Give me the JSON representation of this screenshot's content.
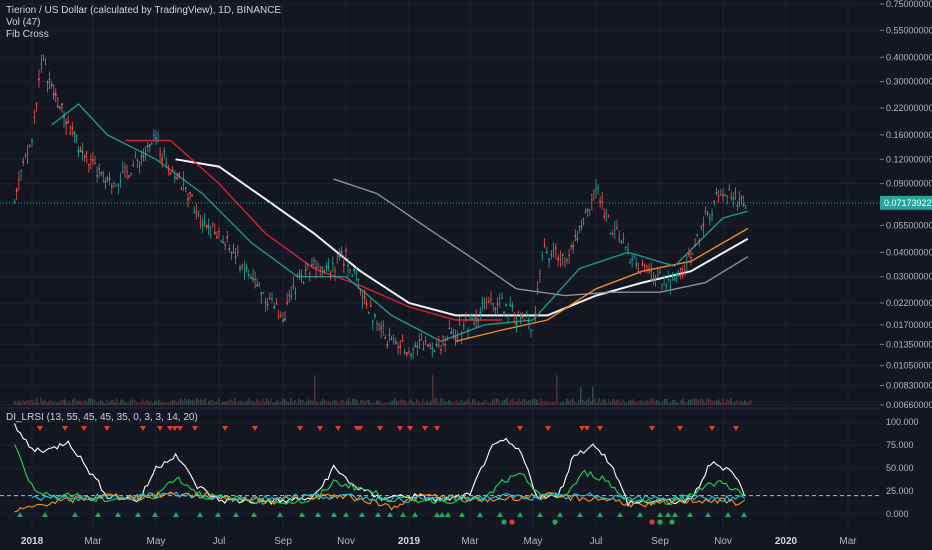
{
  "header": {
    "symbol_title": "Tierion / US Dollar (calculated by TradingView), 1D, BINANCE",
    "vol_label": "Vol (47)",
    "fib_label": "Fib Cross",
    "indicator_label": "DI_LRSI (13, 55, 45, 45, 35, 0, 3, 3, 14, 20)"
  },
  "colors": {
    "background": "#131722",
    "grid": "#1e2230",
    "candle_up": "#26a69a",
    "candle_down": "#ef5350",
    "ma_white": "#ffffff",
    "ma_gray": "#9598a1",
    "ma_orange": "#ff8f1f",
    "ma_red": "#e0233a",
    "ma_teal": "#1f9e89",
    "last_price": "#26a69a"
  },
  "chart_data": {
    "type": "line",
    "x_ticks": [
      "2018",
      "Mar",
      "May",
      "Jul",
      "Sep",
      "Nov",
      "2019",
      "Mar",
      "May",
      "Jul",
      "Sep",
      "Nov",
      "2020",
      "Mar"
    ],
    "bold_ticks": [
      "2018",
      "2019",
      "2020"
    ],
    "price_axis": {
      "scale": "log",
      "ticks": [
        "0.75000000",
        "0.55000000",
        "0.40000000",
        "0.30000000",
        "0.22000000",
        "0.16000000",
        "0.12000000",
        "0.09000000",
        "0.05500000",
        "0.04000000",
        "0.03000000",
        "0.02200000",
        "0.01700000",
        "0.01350000",
        "0.01050000",
        "0.00830000",
        "0.00660000"
      ],
      "last_price": "0.07173922"
    },
    "price_series": {
      "name": "Close",
      "x": [
        "2017-12-15",
        "2018-01-01",
        "2018-01-10",
        "2018-01-20",
        "2018-02-01",
        "2018-02-15",
        "2018-03-01",
        "2018-03-15",
        "2018-04-01",
        "2018-04-15",
        "2018-05-01",
        "2018-05-15",
        "2018-06-01",
        "2018-06-15",
        "2018-07-01",
        "2018-07-15",
        "2018-08-01",
        "2018-08-15",
        "2018-09-01",
        "2018-09-15",
        "2018-10-01",
        "2018-10-15",
        "2018-11-01",
        "2018-11-15",
        "2018-12-01",
        "2018-12-15",
        "2019-01-01",
        "2019-01-15",
        "2019-02-01",
        "2019-02-15",
        "2019-03-01",
        "2019-03-15",
        "2019-04-01",
        "2019-04-15",
        "2019-05-01",
        "2019-05-10",
        "2019-06-01",
        "2019-06-15",
        "2019-07-01",
        "2019-07-15",
        "2019-08-01",
        "2019-08-15",
        "2019-09-01",
        "2019-09-15",
        "2019-10-01",
        "2019-10-15",
        "2019-11-01",
        "2019-11-15",
        "2019-11-25"
      ],
      "y": [
        0.08,
        0.15,
        0.4,
        0.28,
        0.2,
        0.14,
        0.11,
        0.09,
        0.1,
        0.12,
        0.15,
        0.11,
        0.08,
        0.06,
        0.048,
        0.04,
        0.03,
        0.024,
        0.019,
        0.028,
        0.036,
        0.034,
        0.038,
        0.026,
        0.017,
        0.014,
        0.013,
        0.0135,
        0.014,
        0.016,
        0.018,
        0.021,
        0.022,
        0.019,
        0.017,
        0.04,
        0.038,
        0.052,
        0.085,
        0.055,
        0.04,
        0.032,
        0.03,
        0.028,
        0.038,
        0.06,
        0.085,
        0.075,
        0.072
      ]
    },
    "ma_series": [
      {
        "color": "#ffffff",
        "x": [
          "2018-05-20",
          "2018-07-01",
          "2018-08-15",
          "2018-10-01",
          "2018-11-15",
          "2019-01-01",
          "2019-02-15",
          "2019-04-01",
          "2019-05-15",
          "2019-07-01",
          "2019-08-15",
          "2019-10-01",
          "2019-11-25"
        ],
        "y": [
          0.12,
          0.11,
          0.075,
          0.05,
          0.032,
          0.022,
          0.019,
          0.019,
          0.019,
          0.024,
          0.028,
          0.032,
          0.047
        ]
      },
      {
        "color": "#9598a1",
        "x": [
          "2018-10-20",
          "2018-12-01",
          "2019-01-15",
          "2019-03-01",
          "2019-04-15",
          "2019-06-01",
          "2019-07-15",
          "2019-09-01",
          "2019-10-15",
          "2019-11-25"
        ],
        "y": [
          0.095,
          0.08,
          0.055,
          0.038,
          0.026,
          0.024,
          0.025,
          0.025,
          0.028,
          0.038
        ]
      },
      {
        "color": "#ff8f1f",
        "x": [
          "2019-02-15",
          "2019-04-01",
          "2019-05-15",
          "2019-07-01",
          "2019-08-15",
          "2019-10-01",
          "2019-11-25"
        ],
        "y": [
          0.014,
          0.016,
          0.018,
          0.026,
          0.032,
          0.036,
          0.053
        ]
      },
      {
        "color": "#e0233a",
        "x": [
          "2018-04-01",
          "2018-05-15",
          "2018-07-01",
          "2018-08-15",
          "2018-10-01",
          "2018-11-15",
          "2019-01-01",
          "2019-02-15",
          "2019-04-01"
        ],
        "y": [
          0.15,
          0.15,
          0.09,
          0.05,
          0.033,
          0.027,
          0.021,
          0.018,
          0.018
        ]
      },
      {
        "color": "#1f9e89",
        "x": [
          "2018-01-20",
          "2018-02-15",
          "2018-03-15",
          "2018-05-01",
          "2018-06-15",
          "2018-08-01",
          "2018-09-15",
          "2018-11-01",
          "2018-12-15",
          "2019-02-01",
          "2019-03-15",
          "2019-05-01",
          "2019-06-15",
          "2019-08-01",
          "2019-09-15",
          "2019-11-01",
          "2019-11-25"
        ],
        "y": [
          0.18,
          0.23,
          0.16,
          0.12,
          0.08,
          0.045,
          0.03,
          0.03,
          0.019,
          0.014,
          0.017,
          0.018,
          0.033,
          0.04,
          0.034,
          0.06,
          0.065
        ]
      }
    ],
    "osc_axis": {
      "ticks": [
        "100.000",
        "75.000",
        "50.000",
        "25.000",
        "0.000"
      ],
      "range": [
        0,
        100
      ],
      "dashed_level": 20
    },
    "osc_series": [
      {
        "color": "#ffffff",
        "x": [
          "2017-12-15",
          "2018-01-01",
          "2018-01-20",
          "2018-02-05",
          "2018-02-20",
          "2018-03-15",
          "2018-04-15",
          "2018-05-01",
          "2018-05-20",
          "2018-06-10",
          "2018-07-01",
          "2018-08-01",
          "2018-09-01",
          "2018-10-01",
          "2018-10-20",
          "2018-11-10",
          "2018-12-01",
          "2019-01-01",
          "2019-02-01",
          "2019-03-01",
          "2019-03-20",
          "2019-04-05",
          "2019-04-20",
          "2019-05-05",
          "2019-05-25",
          "2019-06-10",
          "2019-07-01",
          "2019-07-15",
          "2019-08-01",
          "2019-09-01",
          "2019-10-01",
          "2019-10-20",
          "2019-11-10",
          "2019-11-25"
        ],
        "y": [
          95,
          70,
          70,
          80,
          55,
          20,
          15,
          50,
          65,
          30,
          15,
          14,
          14,
          18,
          50,
          30,
          18,
          20,
          15,
          20,
          70,
          80,
          65,
          20,
          18,
          65,
          75,
          55,
          12,
          14,
          14,
          55,
          48,
          15
        ]
      },
      {
        "color": "#1fd655",
        "x": [
          "2017-12-15",
          "2018-01-01",
          "2018-01-20",
          "2018-02-05",
          "2018-03-01",
          "2018-04-01",
          "2018-05-01",
          "2018-05-20",
          "2018-06-15",
          "2018-08-01",
          "2018-09-01",
          "2018-10-01",
          "2018-10-20",
          "2018-11-15",
          "2018-12-15",
          "2019-02-01",
          "2019-03-15",
          "2019-04-01",
          "2019-04-20",
          "2019-05-10",
          "2019-06-01",
          "2019-06-20",
          "2019-07-10",
          "2019-07-25",
          "2019-08-15",
          "2019-09-15",
          "2019-10-15",
          "2019-11-01",
          "2019-11-25"
        ],
        "y": [
          75,
          30,
          18,
          22,
          15,
          17,
          20,
          40,
          20,
          15,
          13,
          14,
          35,
          28,
          16,
          15,
          15,
          35,
          42,
          20,
          20,
          45,
          38,
          20,
          14,
          14,
          30,
          35,
          17
        ]
      },
      {
        "color": "#ff8f1f",
        "x": [
          "2017-12-15",
          "2018-01-15",
          "2018-02-15",
          "2018-03-15",
          "2018-04-15",
          "2018-05-15",
          "2018-06-15",
          "2018-07-15",
          "2018-08-15",
          "2018-09-15",
          "2018-10-15",
          "2018-11-15",
          "2018-12-15",
          "2019-01-15",
          "2019-02-15",
          "2019-03-15",
          "2019-04-15",
          "2019-05-15",
          "2019-06-15",
          "2019-07-15",
          "2019-08-15",
          "2019-09-15",
          "2019-10-15",
          "2019-11-25"
        ],
        "y": [
          2,
          12,
          16,
          20,
          18,
          22,
          20,
          17,
          15,
          18,
          20,
          17,
          8,
          20,
          18,
          15,
          18,
          20,
          17,
          16,
          8,
          14,
          15,
          12
        ]
      },
      {
        "color": "#26c6da",
        "x": [
          "2018-01-01",
          "2018-02-15",
          "2018-04-01",
          "2018-05-15",
          "2018-07-01",
          "2018-08-15",
          "2018-10-01",
          "2018-11-15",
          "2019-01-01",
          "2019-02-15",
          "2019-04-01",
          "2019-05-15",
          "2019-07-01",
          "2019-08-15",
          "2019-10-01",
          "2019-11-25"
        ],
        "y": [
          18,
          17,
          19,
          21,
          18,
          17,
          20,
          18,
          16,
          17,
          19,
          18,
          20,
          17,
          18,
          16
        ]
      }
    ]
  }
}
